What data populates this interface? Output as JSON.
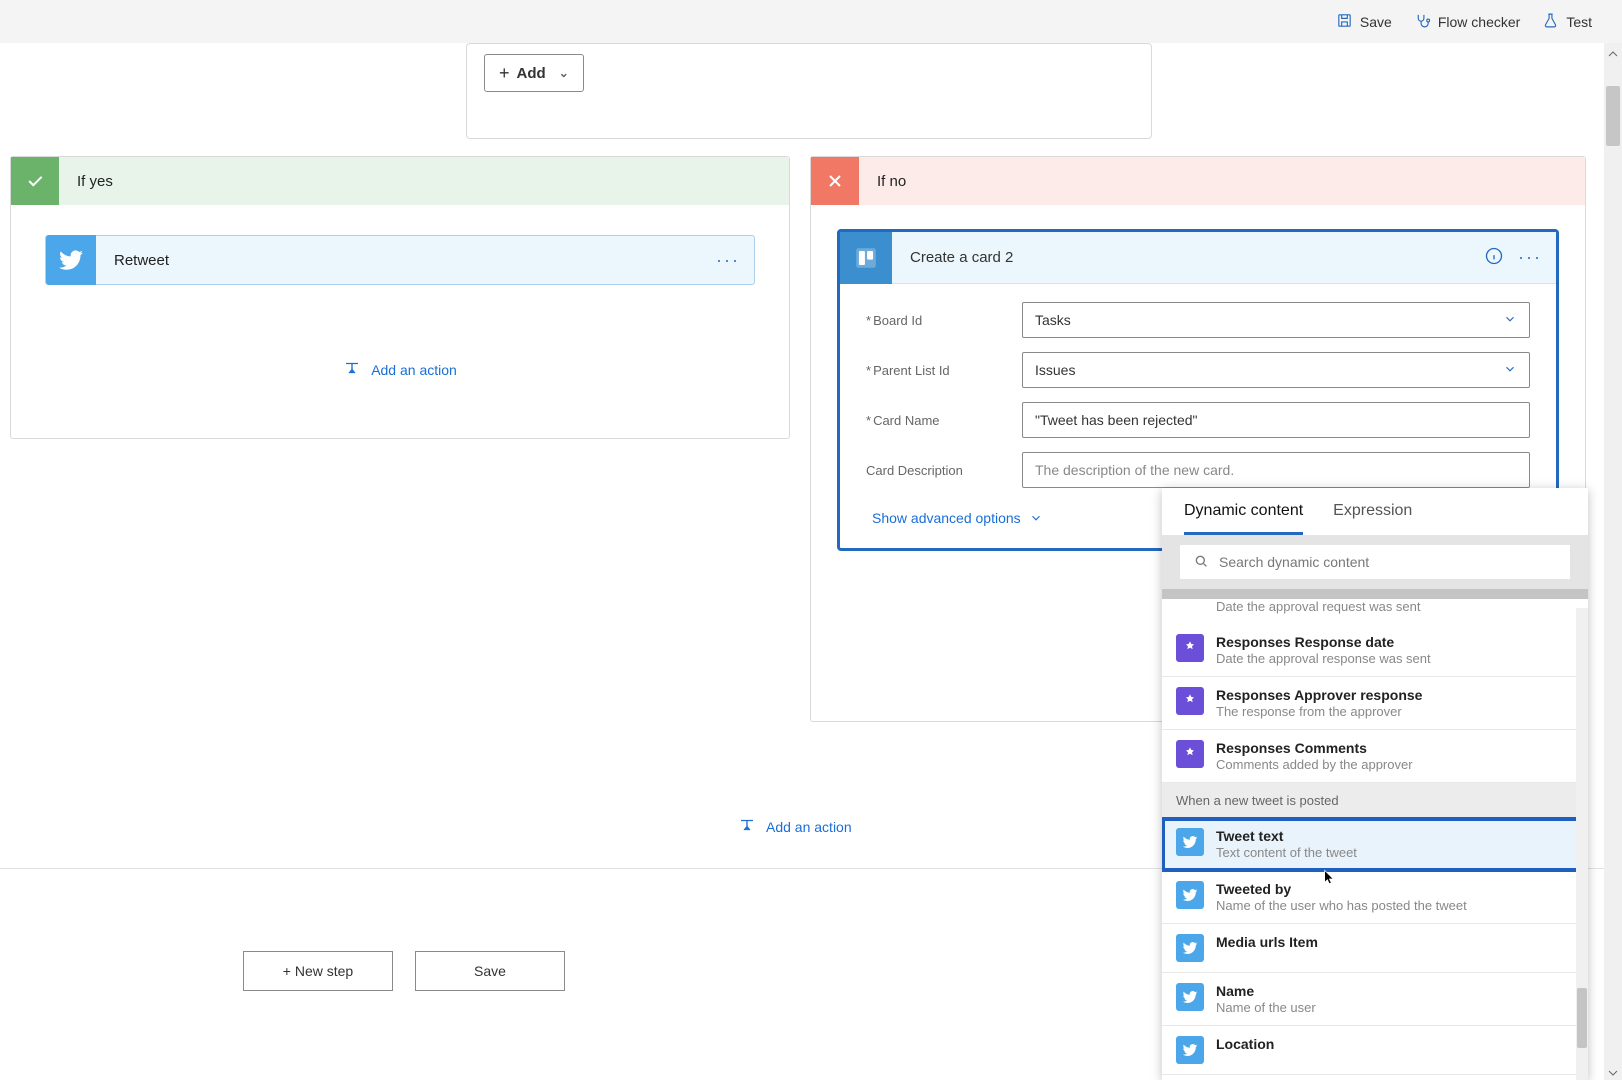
{
  "topbar": {
    "save": "Save",
    "flowchecker": "Flow checker",
    "test": "Test"
  },
  "trigger": {
    "add": "Add"
  },
  "yes": {
    "label": "If yes",
    "retweet": "Retweet",
    "add_action": "Add an action"
  },
  "no": {
    "label": "If no",
    "card_title": "Create a card 2",
    "fields": {
      "board_label": "Board Id",
      "board_value": "Tasks",
      "list_label": "Parent List Id",
      "list_value": "Issues",
      "name_label": "Card Name",
      "name_value": "\"Tweet has been rejected\"",
      "desc_label": "Card Description",
      "desc_placeholder": "The description of the new card."
    },
    "show_advanced": "Show advanced options",
    "add_action": "Add an action"
  },
  "outer_add_action": "Add an action",
  "footer": {
    "new_step": "+ New step",
    "save": "Save"
  },
  "flyout": {
    "tab_dynamic": "Dynamic content",
    "tab_expr": "Expression",
    "search_placeholder": "Search dynamic content",
    "truncated": "Date the approval request was sent",
    "approval_items": [
      {
        "t": "Responses Response date",
        "d": "Date the approval response was sent"
      },
      {
        "t": "Responses Approver response",
        "d": "The response from the approver"
      },
      {
        "t": "Responses Comments",
        "d": "Comments added by the approver"
      }
    ],
    "group_tweet": "When a new tweet is posted",
    "tweet_items": [
      {
        "t": "Tweet text",
        "d": "Text content of the tweet"
      },
      {
        "t": "Tweeted by",
        "d": "Name of the user who has posted the tweet"
      },
      {
        "t": "Media urls Item",
        "d": ""
      },
      {
        "t": "Name",
        "d": "Name of the user"
      },
      {
        "t": "Location",
        "d": ""
      }
    ]
  }
}
